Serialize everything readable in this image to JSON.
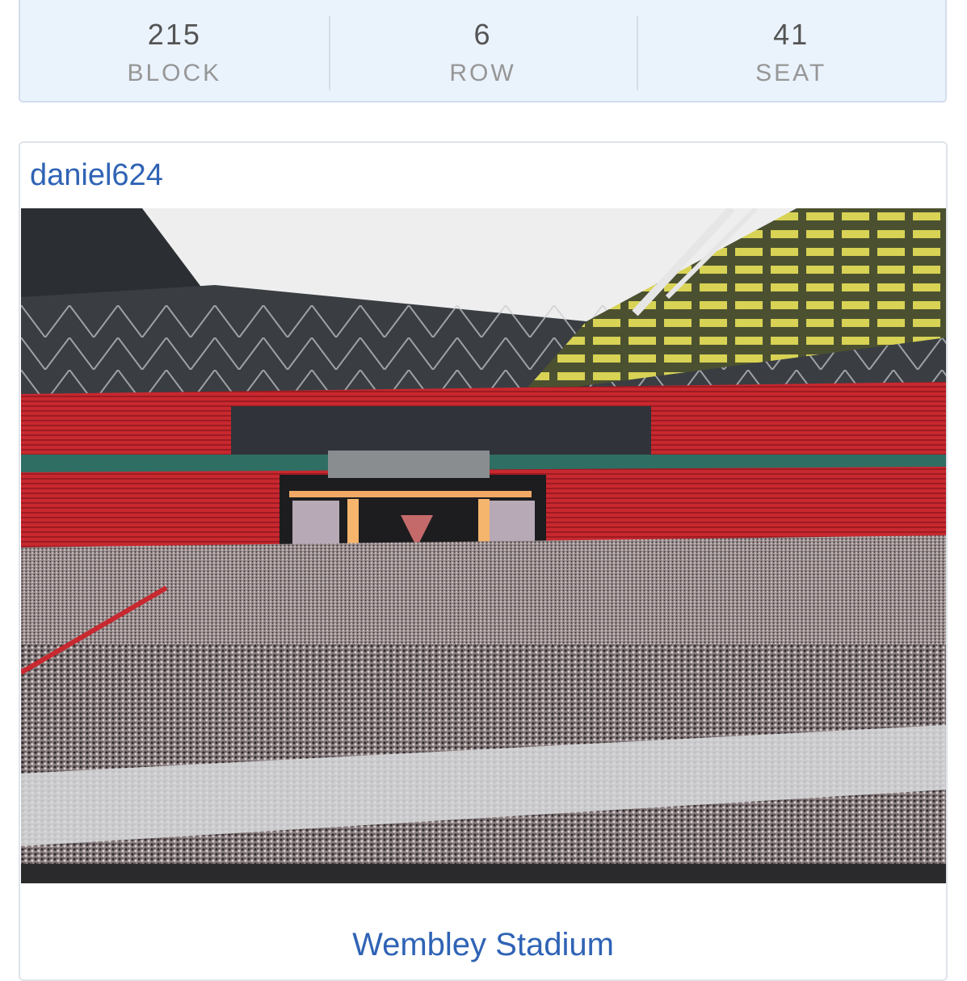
{
  "seat_info": {
    "block": {
      "value": "215",
      "label": "BLOCK"
    },
    "row": {
      "value": "6",
      "label": "ROW"
    },
    "seat": {
      "value": "41",
      "label": "SEAT"
    }
  },
  "photo": {
    "username": "daniel624",
    "venue": "Wembley Stadium",
    "image_description_icon": "stadium-photo"
  },
  "colors": {
    "seat_card_bg": "#eaf2fc",
    "link": "#2f63b5",
    "value_text": "#545454",
    "label_text": "#969696"
  }
}
